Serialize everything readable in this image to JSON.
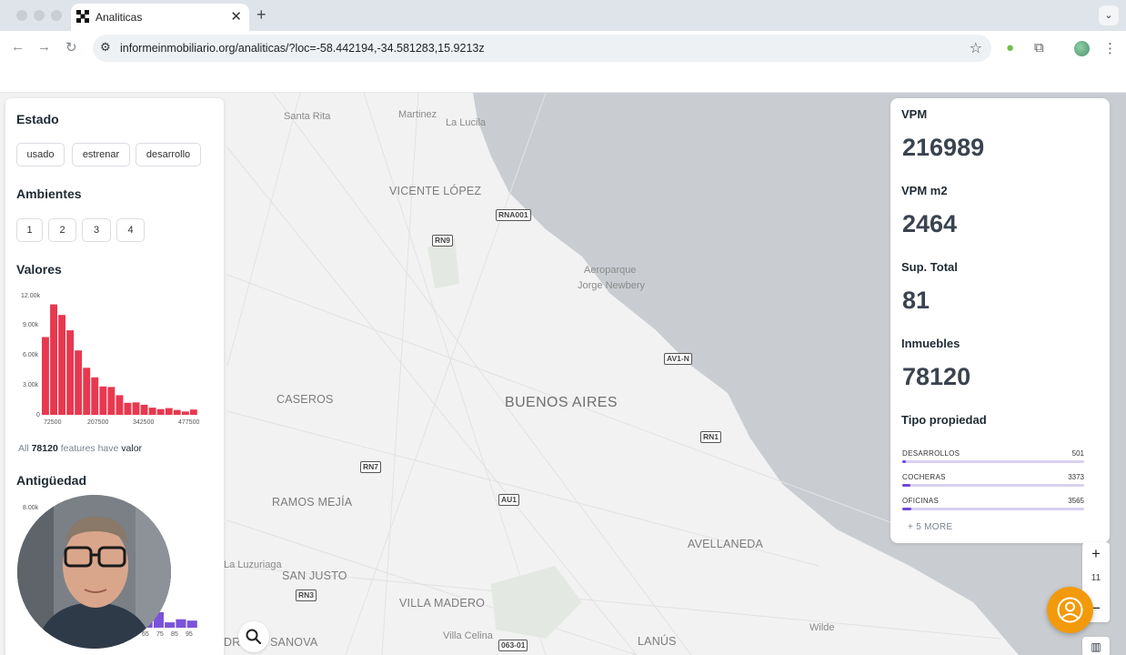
{
  "browser": {
    "tab_title": "Analiticas",
    "new_tab": "+",
    "close": "✕",
    "url": "informeinmobiliario.org/analiticas/?loc=-58.442194,-34.581283,15.9213z"
  },
  "map": {
    "places": [
      "Santa Rita",
      "Martinez",
      "La Lucila",
      "VICENTE LÓPEZ",
      "Aeroparque",
      "Jorge Newbery",
      "CASEROS",
      "BUENOS AIRES",
      "RAMOS MEJÍA",
      "La Luzuriaga",
      "SAN JUSTO",
      "VILLA MADERO",
      "Villa Celina",
      "AVELLANEDA",
      "LANÚS",
      "Wilde",
      "DRO",
      "SANOVA"
    ],
    "roads": [
      "RNA001",
      "RN9",
      "AV1-N",
      "RN1",
      "RN7",
      "AU1",
      "RN3",
      "063-01"
    ]
  },
  "left_panel": {
    "estado": {
      "title": "Estado",
      "options": [
        "usado",
        "estrenar",
        "desarrollo"
      ]
    },
    "ambientes": {
      "title": "Ambientes",
      "options": [
        "1",
        "2",
        "3",
        "4"
      ]
    },
    "valores": {
      "title": "Valores",
      "y_ticks": [
        "12.00k",
        "9.00k",
        "6.00k",
        "3.00k",
        "0"
      ],
      "x_ticks": [
        "72500",
        "207500",
        "342500",
        "477500"
      ],
      "note_prefix": "All",
      "note_count": "78120",
      "note_mid": "features have",
      "note_field": "valor"
    },
    "antiguedad": {
      "title": "Antigüedad",
      "y_ticks": [
        "8.00k"
      ],
      "x_ticks": [
        "65",
        "75",
        "85",
        "95"
      ]
    }
  },
  "chart_data": [
    {
      "type": "bar",
      "title": "Valores",
      "categories": [
        "72500",
        "",
        "",
        "",
        "",
        "",
        "207500",
        "",
        "",
        "",
        "",
        "",
        "342500",
        "",
        "",
        "",
        "",
        "",
        "477500"
      ],
      "values": [
        8100,
        11500,
        10400,
        8800,
        6700,
        4900,
        3900,
        2950,
        2900,
        2050,
        1250,
        1300,
        1050,
        750,
        600,
        700,
        500,
        350,
        550
      ],
      "ylim": [
        0,
        12500
      ],
      "color": "#e8384f"
    },
    {
      "type": "bar",
      "title": "Antigüedad",
      "categories": [
        "",
        "",
        "",
        "",
        "",
        "",
        "",
        "65",
        "",
        "75",
        "",
        "85",
        "",
        "95"
      ],
      "values": [
        0,
        0,
        0,
        0,
        0,
        0,
        0,
        450,
        1250,
        450,
        1100,
        380,
        600,
        500
      ],
      "ylim": [
        0,
        8500
      ],
      "color": "#7b52db"
    }
  ],
  "right_panel": {
    "vpm": {
      "label": "VPM",
      "value": "216989"
    },
    "vpm_m2": {
      "label": "VPM m2",
      "value": "2464"
    },
    "sup_total": {
      "label": "Sup. Total",
      "value": "81"
    },
    "inmuebles": {
      "label": "Inmuebles",
      "value": "78120"
    },
    "tipo": {
      "title": "Tipo propiedad",
      "items": [
        {
          "name": "DESARROLLOS",
          "count": "501",
          "fraction": 0.02
        },
        {
          "name": "COCHERAS",
          "count": "3373",
          "fraction": 0.045
        },
        {
          "name": "OFICINAS",
          "count": "3565",
          "fraction": 0.048
        }
      ],
      "more": "+ 5 MORE"
    }
  },
  "controls": {
    "zoom_in": "+",
    "zoom_level": "11",
    "zoom_out": "−"
  },
  "colors": {
    "accent_bar": "#e8384f",
    "accent_purple": "#6f4ad6",
    "support_button": "#f39a0c",
    "water": "#c9cdd1"
  }
}
